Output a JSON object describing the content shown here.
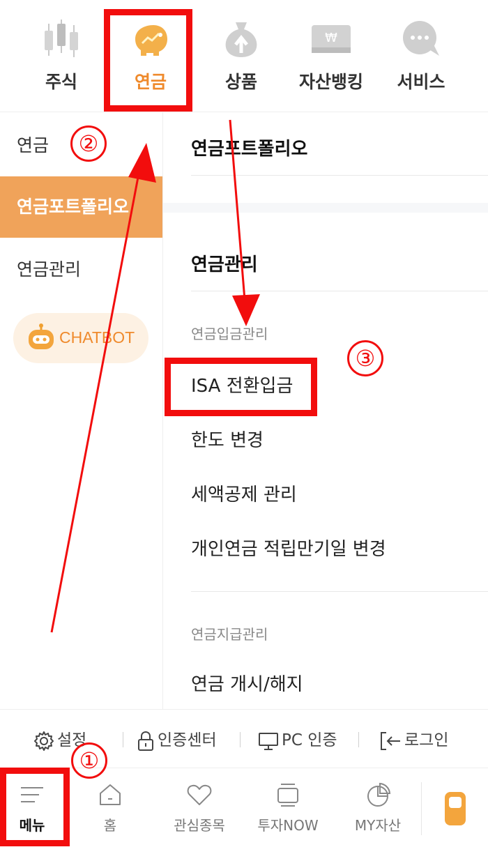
{
  "top_tabs": [
    {
      "label": "주식",
      "icon": "candlestick-chart-icon"
    },
    {
      "label": "연금",
      "icon": "piggy-bank-icon"
    },
    {
      "label": "상품",
      "icon": "money-bag-icon"
    },
    {
      "label": "자산뱅킹",
      "icon": "won-card-icon"
    },
    {
      "label": "서비스",
      "icon": "chat-bubble-icon"
    }
  ],
  "active_tab": "연금",
  "sidebar": {
    "items": [
      {
        "label": "연금"
      },
      {
        "label": "연금포트폴리오"
      },
      {
        "label": "연금관리"
      }
    ],
    "chatbot_label": "CHATBOT"
  },
  "content": {
    "portfolio_title": "연금포트폴리오",
    "manage_title": "연금관리",
    "deposit_group": "연금입금관리",
    "deposit_links": [
      "ISA 전환입금",
      "한도 변경",
      "세액공제 관리",
      "개인연금 적립만기일 변경"
    ],
    "payout_group": "연금지급관리",
    "payout_links": [
      "연금 개시/해지"
    ]
  },
  "settings_row": [
    {
      "label": "설정",
      "icon": "gear-icon"
    },
    {
      "label": "인증센터",
      "icon": "lock-icon"
    },
    {
      "label": "PC 인증",
      "icon": "monitor-icon"
    },
    {
      "label": "로그인",
      "icon": "login-icon"
    }
  ],
  "bottom_nav": [
    {
      "label": "메뉴",
      "icon": "menu-icon"
    },
    {
      "label": "홈",
      "icon": "home-icon"
    },
    {
      "label": "관심종목",
      "icon": "heart-icon"
    },
    {
      "label": "투자NOW",
      "icon": "tv-icon"
    },
    {
      "label": "MY자산",
      "icon": "pie-chart-icon"
    }
  ],
  "annotations": {
    "step1": "①",
    "step2": "②",
    "step3": "③"
  },
  "colors": {
    "accent": "#ef8a2c",
    "sidebar_active_bg": "#f0a35a",
    "annotation_red": "#f20d0d"
  }
}
